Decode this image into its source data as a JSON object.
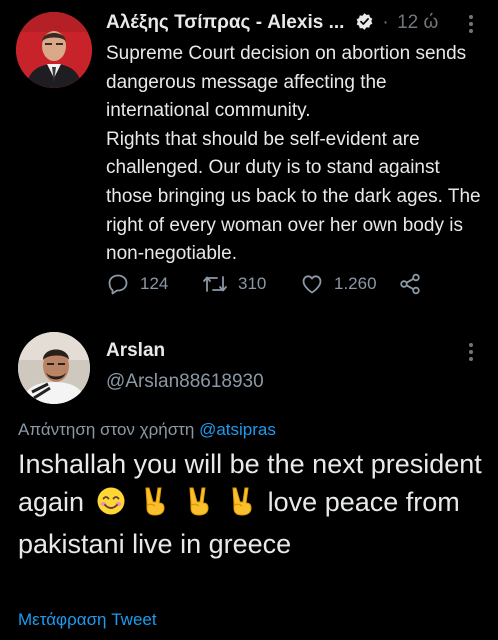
{
  "tweet": {
    "author_name": "Αλέξης Τσίπρας - Alexis ...",
    "separator": "·",
    "time": "12 ώ",
    "text": "Supreme Court decision on abortion sends dangerous message affecting the international community.\nRights that should be self-evident are challenged. Our duty is to stand against those bringing us back to the dark ages. The right of every woman over her own body is non-negotiable.",
    "replies": "124",
    "retweets": "310",
    "likes": "1.260",
    "icons": [
      "verified-icon",
      "more-icon",
      "reply-icon",
      "retweet-icon",
      "like-icon",
      "share-icon"
    ]
  },
  "reply": {
    "author_name": "Arslan",
    "handle": "@Arslan88618930",
    "replying_to_prefix": "Απάντηση στον χρήστη",
    "replying_to_mention": "@atsipras",
    "text_part1": "Inshallah you will be the next president again",
    "text_part2": "love peace from pakistani live in greece",
    "emojis": [
      "smiling-face-icon",
      "victory-hand-icon",
      "victory-hand-icon",
      "victory-hand-icon"
    ],
    "translate_label": "Μετάφραση Tweet"
  },
  "colors": {
    "background": "#000000",
    "text": "#e7e9ea",
    "secondary": "#8b98a5",
    "link": "#1d9bf0"
  }
}
